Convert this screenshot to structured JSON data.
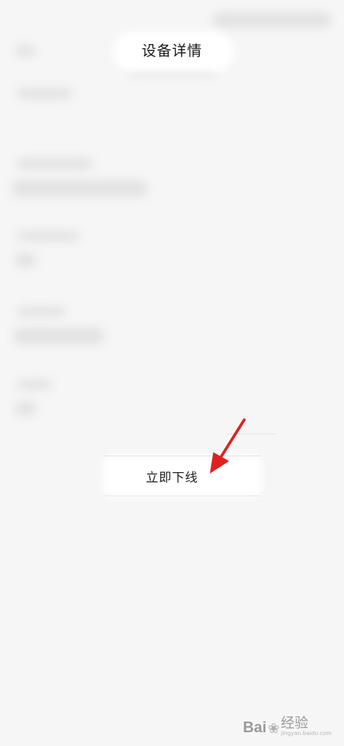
{
  "header": {
    "title": "设备详情"
  },
  "actions": {
    "offline_label": "立即下线"
  },
  "annotation": {
    "arrow_color": "#e02020"
  },
  "watermark": {
    "brand": "Bai",
    "cn": "经验",
    "domain": "jingyan.baidu.com"
  },
  "colors": {
    "background": "#f6f6f6",
    "text": "#1e1e1e"
  }
}
